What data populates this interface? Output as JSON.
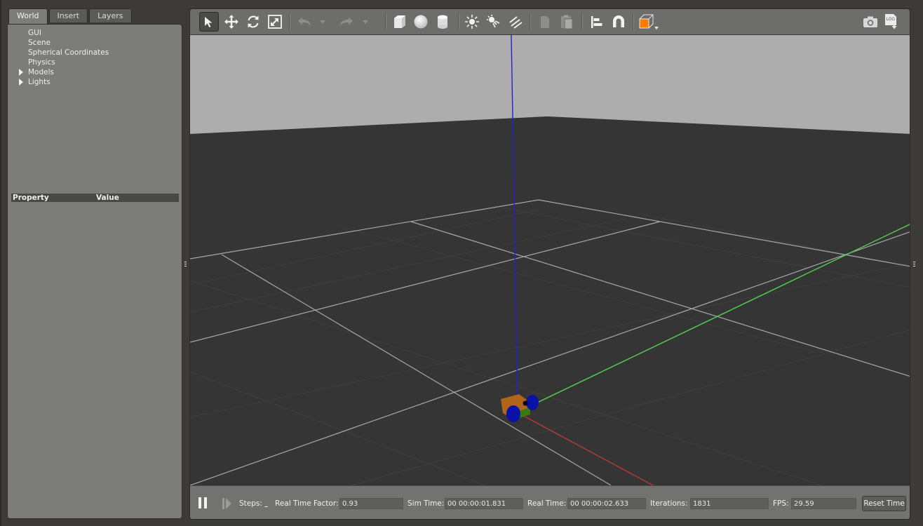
{
  "tabs": [
    "World",
    "Insert",
    "Layers"
  ],
  "tree": {
    "items": [
      {
        "label": "GUI",
        "expandable": false
      },
      {
        "label": "Scene",
        "expandable": false
      },
      {
        "label": "Spherical Coordinates",
        "expandable": false
      },
      {
        "label": "Physics",
        "expandable": false
      },
      {
        "label": "Models",
        "expandable": true
      },
      {
        "label": "Lights",
        "expandable": true
      }
    ]
  },
  "properties": {
    "col_property": "Property",
    "col_value": "Value"
  },
  "toolbar": {
    "icons": [
      "select-arrow-icon",
      "translate-icon",
      "rotate-icon",
      "scale-icon",
      "undo-icon",
      "undo-dropdown-icon",
      "redo-icon",
      "redo-dropdown-icon",
      "box-shape-icon",
      "sphere-shape-icon",
      "cylinder-shape-icon",
      "point-light-icon",
      "spot-light-icon",
      "directional-light-icon",
      "copy-icon",
      "paste-icon",
      "align-icon",
      "snap-magnet-icon",
      "view-angle-icon",
      "screenshot-camera-icon",
      "log-icon"
    ],
    "log_text": "LOG"
  },
  "bottom": {
    "steps_label": "Steps:",
    "rtf_label": "Real Time Factor:",
    "rtf_value": "0.93",
    "sim_label": "Sim Time:",
    "sim_value": "00 00:00:01.831",
    "real_label": "Real Time:",
    "real_value": "00 00:00:02.633",
    "iter_label": "Iterations:",
    "iter_value": "1831",
    "fps_label": "FPS:",
    "fps_value": "29.59",
    "reset_label": "Reset Time"
  },
  "colors": {
    "sky": "#adadad",
    "ground": "#353535",
    "axis_x": "#d03838",
    "axis_y": "#50d050",
    "axis_z": "#2222cc",
    "robot_body": "#b0651a",
    "robot_wheel": "#0a12a8",
    "selected_accent": "#ff7a00"
  }
}
